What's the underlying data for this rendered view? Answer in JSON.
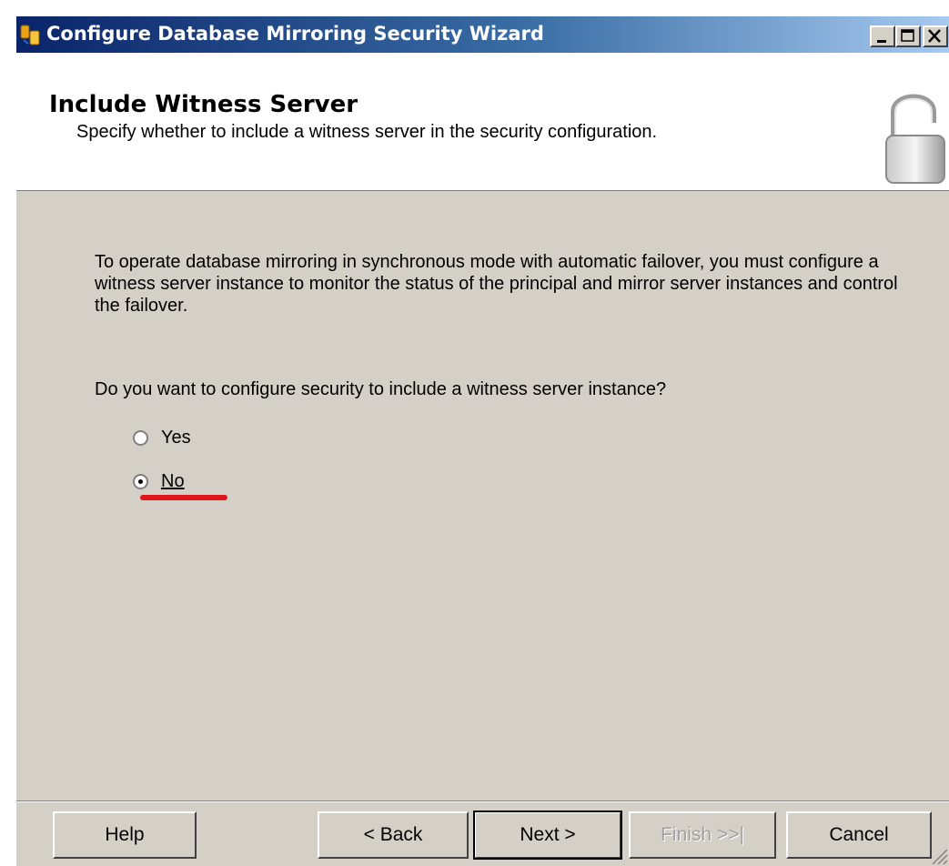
{
  "window": {
    "title": "Configure Database Mirroring Security Wizard",
    "controls": {
      "minimize": "_",
      "maximize": "□",
      "close": "X"
    },
    "icon": "database-mirroring-icon"
  },
  "header": {
    "title": "Include Witness Server",
    "subtitle": "Specify whether to include a witness server in the security configuration.",
    "icon": "padlock-icon"
  },
  "body": {
    "description": "To operate database mirroring in synchronous mode with automatic failover, you must configure a witness server instance to monitor the status of the principal and mirror server instances and control the failover.",
    "question": "Do you want to configure security to include a witness server instance?",
    "options": [
      {
        "label": "Yes",
        "selected": false
      },
      {
        "label": "No",
        "selected": true
      }
    ]
  },
  "footer": {
    "help": "Help",
    "back": "< Back",
    "next": "Next >",
    "finish": "Finish >>|",
    "cancel": "Cancel"
  },
  "colors": {
    "titlebar_start": "#0a246a",
    "titlebar_end": "#a6caf0",
    "dialog_bg": "#d4d0c8",
    "annotation_red": "#e0161c"
  }
}
